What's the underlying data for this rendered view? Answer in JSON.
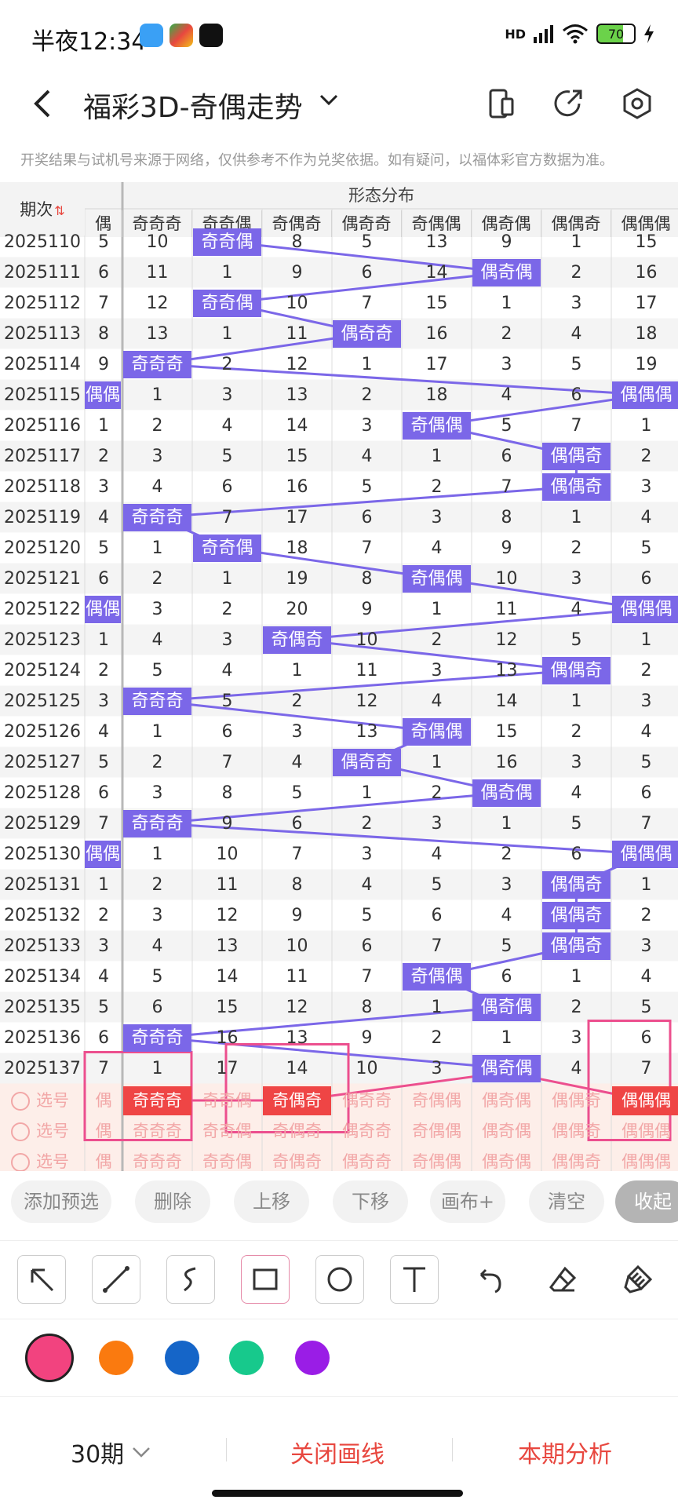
{
  "status_bar": {
    "time": "半夜12:34",
    "battery": "70",
    "network": "HD"
  },
  "header": {
    "title": "福彩3D-奇偶走势"
  },
  "notice": "开奖结果与试机号来源于网络，仅供参考不作为兑奖依据。如有疑问，以福体彩官方数据为准。",
  "table": {
    "period_header": "期次",
    "group_header": "形态分布",
    "partial_col_header": "偶",
    "columns": [
      "奇奇奇",
      "奇奇偶",
      "奇偶奇",
      "偶奇奇",
      "奇偶偶",
      "偶奇偶",
      "偶偶奇",
      "偶偶偶"
    ],
    "rows": [
      {
        "period": "2025110",
        "partial": "5",
        "cells": [
          "10",
          "奇奇偶",
          "8",
          "5",
          "13",
          "9",
          "1",
          "15"
        ],
        "hit": 1
      },
      {
        "period": "2025111",
        "partial": "6",
        "cells": [
          "11",
          "1",
          "9",
          "6",
          "14",
          "偶奇偶",
          "2",
          "16"
        ],
        "hit": 5
      },
      {
        "period": "2025112",
        "partial": "7",
        "cells": [
          "12",
          "奇奇偶",
          "10",
          "7",
          "15",
          "1",
          "3",
          "17"
        ],
        "hit": 1
      },
      {
        "period": "2025113",
        "partial": "8",
        "cells": [
          "13",
          "1",
          "11",
          "偶奇奇",
          "16",
          "2",
          "4",
          "18"
        ],
        "hit": 3
      },
      {
        "period": "2025114",
        "partial": "9",
        "cells": [
          "奇奇奇",
          "2",
          "12",
          "1",
          "17",
          "3",
          "5",
          "19"
        ],
        "hit": 0
      },
      {
        "period": "2025115",
        "partial": "偶偶",
        "cells": [
          "1",
          "3",
          "13",
          "2",
          "18",
          "4",
          "6",
          "偶偶偶"
        ],
        "hit": 7
      },
      {
        "period": "2025116",
        "partial": "1",
        "cells": [
          "2",
          "4",
          "14",
          "3",
          "奇偶偶",
          "5",
          "7",
          "1"
        ],
        "hit": 4
      },
      {
        "period": "2025117",
        "partial": "2",
        "cells": [
          "3",
          "5",
          "15",
          "4",
          "1",
          "6",
          "偶偶奇",
          "2"
        ],
        "hit": 6
      },
      {
        "period": "2025118",
        "partial": "3",
        "cells": [
          "4",
          "6",
          "16",
          "5",
          "2",
          "7",
          "偶偶奇",
          "3"
        ],
        "hit": 6
      },
      {
        "period": "2025119",
        "partial": "4",
        "cells": [
          "奇奇奇",
          "7",
          "17",
          "6",
          "3",
          "8",
          "1",
          "4"
        ],
        "hit": 0
      },
      {
        "period": "2025120",
        "partial": "5",
        "cells": [
          "1",
          "奇奇偶",
          "18",
          "7",
          "4",
          "9",
          "2",
          "5"
        ],
        "hit": 1
      },
      {
        "period": "2025121",
        "partial": "6",
        "cells": [
          "2",
          "1",
          "19",
          "8",
          "奇偶偶",
          "10",
          "3",
          "6"
        ],
        "hit": 4
      },
      {
        "period": "2025122",
        "partial": "偶偶",
        "cells": [
          "3",
          "2",
          "20",
          "9",
          "1",
          "11",
          "4",
          "偶偶偶"
        ],
        "hit": 7
      },
      {
        "period": "2025123",
        "partial": "1",
        "cells": [
          "4",
          "3",
          "奇偶奇",
          "10",
          "2",
          "12",
          "5",
          "1"
        ],
        "hit": 2
      },
      {
        "period": "2025124",
        "partial": "2",
        "cells": [
          "5",
          "4",
          "1",
          "11",
          "3",
          "13",
          "偶偶奇",
          "2"
        ],
        "hit": 6
      },
      {
        "period": "2025125",
        "partial": "3",
        "cells": [
          "奇奇奇",
          "5",
          "2",
          "12",
          "4",
          "14",
          "1",
          "3"
        ],
        "hit": 0
      },
      {
        "period": "2025126",
        "partial": "4",
        "cells": [
          "1",
          "6",
          "3",
          "13",
          "奇偶偶",
          "15",
          "2",
          "4"
        ],
        "hit": 4
      },
      {
        "period": "2025127",
        "partial": "5",
        "cells": [
          "2",
          "7",
          "4",
          "偶奇奇",
          "1",
          "16",
          "3",
          "5"
        ],
        "hit": 3
      },
      {
        "period": "2025128",
        "partial": "6",
        "cells": [
          "3",
          "8",
          "5",
          "1",
          "2",
          "偶奇偶",
          "4",
          "6"
        ],
        "hit": 5
      },
      {
        "period": "2025129",
        "partial": "7",
        "cells": [
          "奇奇奇",
          "9",
          "6",
          "2",
          "3",
          "1",
          "5",
          "7"
        ],
        "hit": 0
      },
      {
        "period": "2025130",
        "partial": "偶偶",
        "cells": [
          "1",
          "10",
          "7",
          "3",
          "4",
          "2",
          "6",
          "偶偶偶"
        ],
        "hit": 7
      },
      {
        "period": "2025131",
        "partial": "1",
        "cells": [
          "2",
          "11",
          "8",
          "4",
          "5",
          "3",
          "偶偶奇",
          "1"
        ],
        "hit": 6
      },
      {
        "period": "2025132",
        "partial": "2",
        "cells": [
          "3",
          "12",
          "9",
          "5",
          "6",
          "4",
          "偶偶奇",
          "2"
        ],
        "hit": 6
      },
      {
        "period": "2025133",
        "partial": "3",
        "cells": [
          "4",
          "13",
          "10",
          "6",
          "7",
          "5",
          "偶偶奇",
          "3"
        ],
        "hit": 6
      },
      {
        "period": "2025134",
        "partial": "4",
        "cells": [
          "5",
          "14",
          "11",
          "7",
          "奇偶偶",
          "6",
          "1",
          "4"
        ],
        "hit": 4
      },
      {
        "period": "2025135",
        "partial": "5",
        "cells": [
          "6",
          "15",
          "12",
          "8",
          "1",
          "偶奇偶",
          "2",
          "5"
        ],
        "hit": 5
      },
      {
        "period": "2025136",
        "partial": "6",
        "cells": [
          "奇奇奇",
          "16",
          "13",
          "9",
          "2",
          "1",
          "3",
          "6"
        ],
        "hit": 0
      },
      {
        "period": "2025137",
        "partial": "7",
        "cells": [
          "1",
          "17",
          "14",
          "10",
          "3",
          "偶奇偶",
          "4",
          "7"
        ],
        "hit": 5
      }
    ],
    "selection_label": "选号",
    "selection_rows": [
      {
        "partial": "偶",
        "cells": [
          "奇奇奇",
          "奇奇偶",
          "奇偶奇",
          "偶奇奇",
          "奇偶偶",
          "偶奇偶",
          "偶偶奇",
          "偶偶偶"
        ],
        "selected": [
          0,
          2,
          7
        ]
      },
      {
        "partial": "偶",
        "cells": [
          "奇奇奇",
          "奇奇偶",
          "奇偶奇",
          "偶奇奇",
          "奇偶偶",
          "偶奇偶",
          "偶偶奇",
          "偶偶偶"
        ],
        "selected": []
      },
      {
        "partial": "偶",
        "cells": [
          "奇奇奇",
          "奇奇偶",
          "奇偶奇",
          "偶奇奇",
          "奇偶偶",
          "偶奇偶",
          "偶偶奇",
          "偶偶偶"
        ],
        "selected": []
      }
    ]
  },
  "actions": [
    "添加预选",
    "删除",
    "上移",
    "下移",
    "画布+",
    "清空",
    "收起"
  ],
  "tools": [
    "arrow-tool-icon",
    "line-tool-icon",
    "freehand-tool-icon",
    "rectangle-tool-icon",
    "circle-tool-icon",
    "text-tool-icon",
    "undo-icon",
    "eraser-icon",
    "clear-canvas-icon"
  ],
  "palette": [
    "#f2437f",
    "#fa7a0f",
    "#1565c8",
    "#17c98c",
    "#9a1de6"
  ],
  "selected_color": "#f2437f",
  "bottom_bar": {
    "period_select": "30期",
    "close_drawing": "关闭画线",
    "analysis": "本期分析"
  },
  "colors": {
    "hit": "#7b67e8",
    "selected": "#ef4545",
    "annotation": "#ec4f8e",
    "accent_text": "#e8473f"
  }
}
